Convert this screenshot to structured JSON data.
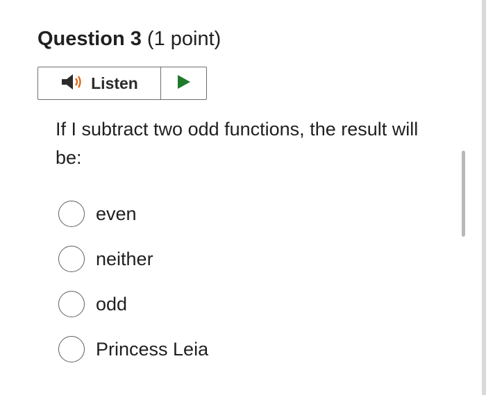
{
  "question": {
    "number_label": "Question 3",
    "points_label": "(1 point)",
    "prompt": "If I subtract two odd functions, the result will be:"
  },
  "listen": {
    "label": "Listen",
    "speaker_icon": "speaker-icon",
    "play_icon": "play-icon",
    "speaker_color": "#e06a1b",
    "play_color": "#1f7a2c"
  },
  "options": [
    {
      "label": "even",
      "selected": false
    },
    {
      "label": "neither",
      "selected": false
    },
    {
      "label": "odd",
      "selected": false
    },
    {
      "label": "Princess Leia",
      "selected": false
    }
  ]
}
